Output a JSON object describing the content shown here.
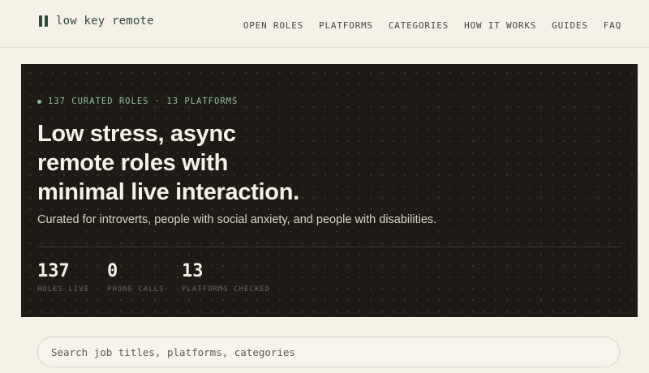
{
  "brand": {
    "name": "low key remote",
    "icon": "pause-bars-icon"
  },
  "nav": {
    "items": [
      {
        "label": "OPEN ROLES"
      },
      {
        "label": "PLATFORMS"
      },
      {
        "label": "CATEGORIES"
      },
      {
        "label": "HOW IT WORKS"
      },
      {
        "label": "GUIDES"
      },
      {
        "label": "FAQ"
      }
    ]
  },
  "hero": {
    "eyebrow": "137 CURATED ROLES · 13 PLATFORMS",
    "headline": [
      "Low stress, async",
      "remote roles with",
      "minimal live interaction."
    ],
    "subhead": "Curated for introverts, people with social anxiety, and people with disabilities.",
    "stats": [
      {
        "value": "137",
        "label": "ROLES LIVE"
      },
      {
        "value": "0",
        "label": "PHONE CALLS"
      },
      {
        "value": "13",
        "label": "PLATFORMS CHECKED"
      }
    ]
  },
  "search": {
    "placeholder": "Search job titles, platforms, categories",
    "value": ""
  },
  "colors": {
    "background": "#f6f1e7",
    "hero_background": "#1e1a16",
    "accent_green": "#8fbf99",
    "brand_green": "#2f4a3a"
  }
}
